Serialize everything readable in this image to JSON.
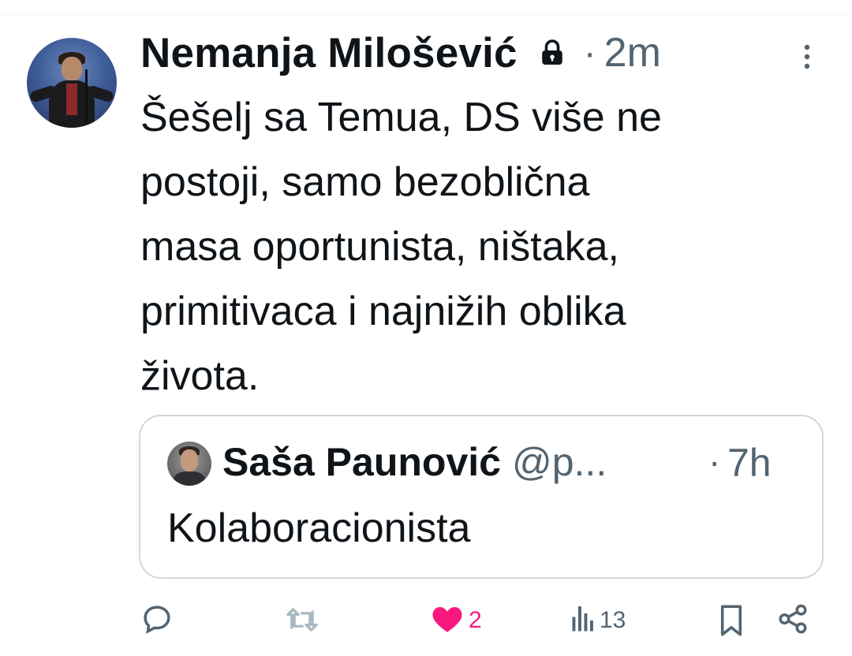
{
  "tweet": {
    "author_name": "Nemanja Milošević",
    "dot": "·",
    "time": "2m",
    "text": "Šešelj sa Temua, DS više ne\npostoji, samo bezoblična\nmasa oportunista, ništaka,\nprimitivaca i najnižih oblika\nživota."
  },
  "quote": {
    "author_name": "Saša Paunović",
    "handle": "@p...",
    "dot": "·",
    "time": "7h",
    "text": "Kolaboracionista"
  },
  "actions": {
    "likes": "2",
    "views": "13"
  },
  "colors": {
    "text_primary": "#0f1419",
    "text_secondary": "#536471",
    "like_pink": "#f91880",
    "retweet_muted": "#8b98a5",
    "border": "#cfd9de"
  },
  "icons": [
    "lock-icon",
    "more-icon",
    "reply-icon",
    "retweet-icon",
    "like-icon",
    "views-icon",
    "bookmark-icon",
    "share-icon"
  ]
}
